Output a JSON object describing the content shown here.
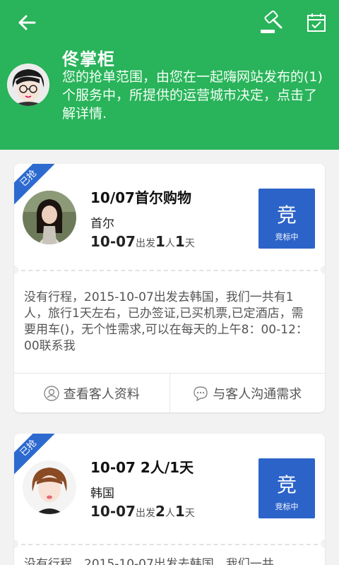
{
  "header": {
    "name": "佟掌柜",
    "description": "您的抢单范围，由您在一起嗨网站发布的(1)个服务中，所提供的运营城市决定，点击了解详情.",
    "icons": {
      "back": "back-arrow-icon",
      "bid": "gavel-icon",
      "calendar": "calendar-check-icon"
    },
    "bg_color": "#29b35a"
  },
  "trips": [
    {
      "badge": "已抢",
      "title": "10/07首尔购物",
      "destination": "首尔",
      "date": "10-07",
      "depart_label": "出发",
      "people": "1",
      "people_unit": "人",
      "days": "1",
      "days_unit": "天",
      "bid_char": "竞",
      "bid_status": "竞标中",
      "description": "没有行程，2015-10-07出发去韩国，我们一共有1人，旅行1天左右，已办签证,已买机票,已定酒店，需要用车()，无个性需求,可以在每天的上午8：00-12：00联系我",
      "actions": [
        "查看客人资料",
        "与客人沟通需求"
      ]
    },
    {
      "badge": "已抢",
      "title": "10-07 2人/1天",
      "destination": "韩国",
      "date": "10-07",
      "depart_label": "出发",
      "people": "2",
      "people_unit": "人",
      "days": "1",
      "days_unit": "天",
      "bid_char": "竞",
      "bid_status": "竞标中",
      "description": "没有行程，2015-10-07出发去韩国，我们一共"
    }
  ],
  "colors": {
    "accent_green": "#29b35a",
    "bid_blue": "#2c63c9",
    "badge_blue": "#2d6ad0"
  }
}
